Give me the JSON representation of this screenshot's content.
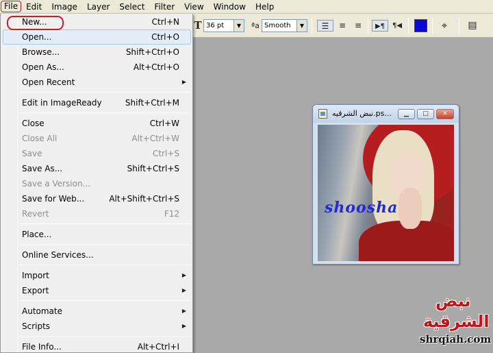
{
  "menubar": [
    "File",
    "Edit",
    "Image",
    "Layer",
    "Select",
    "Filter",
    "View",
    "Window",
    "Help"
  ],
  "toolbar": {
    "font_size": "36 pt",
    "aa_label": "aa",
    "antialias": "Smooth",
    "color_swatch": "#0a0ad6"
  },
  "file_menu": {
    "new": {
      "label": "New...",
      "shortcut": "Ctrl+N"
    },
    "open": {
      "label": "Open...",
      "shortcut": "Ctrl+O"
    },
    "browse": {
      "label": "Browse...",
      "shortcut": "Shift+Ctrl+O"
    },
    "open_as": {
      "label": "Open As...",
      "shortcut": "Alt+Ctrl+O"
    },
    "open_recent": {
      "label": "Open Recent"
    },
    "edit_imageready": {
      "label": "Edit in ImageReady",
      "shortcut": "Shift+Ctrl+M"
    },
    "close": {
      "label": "Close",
      "shortcut": "Ctrl+W"
    },
    "close_all": {
      "label": "Close All",
      "shortcut": "Alt+Ctrl+W"
    },
    "save": {
      "label": "Save",
      "shortcut": "Ctrl+S"
    },
    "save_as": {
      "label": "Save As...",
      "shortcut": "Shift+Ctrl+S"
    },
    "save_version": {
      "label": "Save a Version..."
    },
    "save_web": {
      "label": "Save for Web...",
      "shortcut": "Alt+Shift+Ctrl+S"
    },
    "revert": {
      "label": "Revert",
      "shortcut": "F12"
    },
    "place": {
      "label": "Place..."
    },
    "online_services": {
      "label": "Online Services..."
    },
    "import": {
      "label": "Import"
    },
    "export": {
      "label": "Export"
    },
    "automate": {
      "label": "Automate"
    },
    "scripts": {
      "label": "Scripts"
    },
    "file_info": {
      "label": "File Info...",
      "shortcut": "Alt+Ctrl+I"
    }
  },
  "document": {
    "title": "نبض الشرقيه.ps...",
    "signature": "shoosha"
  },
  "watermark": {
    "line1": "نبض",
    "line2": "الشرقية",
    "site": "shrqiah.com"
  }
}
